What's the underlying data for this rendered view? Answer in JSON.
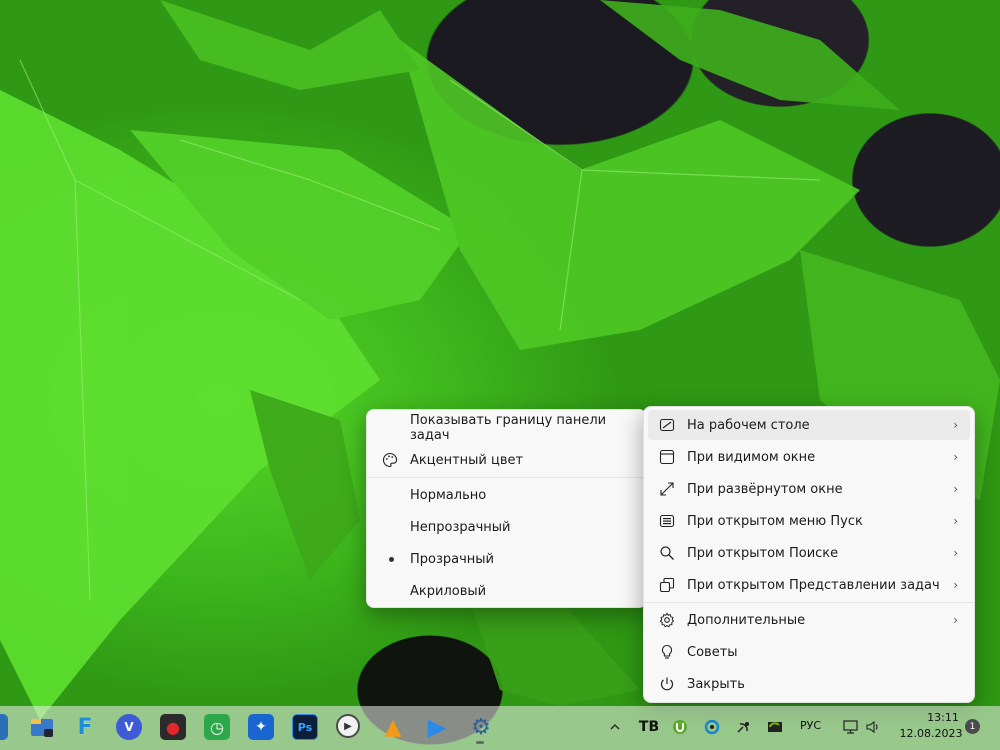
{
  "left_menu": {
    "items": [
      {
        "label": "Показывать границу панели задач",
        "icon": ""
      },
      {
        "label": "Акцентный цвет",
        "icon": "palette-icon"
      },
      {
        "label": "Нормально"
      },
      {
        "label": "Непрозрачный"
      },
      {
        "label": "Прозрачный",
        "selected": true
      },
      {
        "label": "Акриловый"
      }
    ]
  },
  "right_menu": {
    "items": [
      {
        "label": "На рабочем столе",
        "icon": "desktop-icon",
        "submenu": true,
        "highlighted": true
      },
      {
        "label": "При видимом окне",
        "icon": "window-icon",
        "submenu": true
      },
      {
        "label": "При развёрнутом окне",
        "icon": "maximize-icon",
        "submenu": true
      },
      {
        "label": "При открытом меню Пуск",
        "icon": "start-menu-icon",
        "submenu": true
      },
      {
        "label": "При открытом Поиске",
        "icon": "search-icon",
        "submenu": true
      },
      {
        "label": "При открытом Представлении задач",
        "icon": "task-view-icon",
        "submenu": true
      },
      {
        "label": "Дополнительные",
        "icon": "gear-icon",
        "submenu": true
      },
      {
        "label": "Советы",
        "icon": "lightbulb-icon"
      },
      {
        "label": "Закрыть",
        "icon": "power-icon"
      }
    ],
    "chevron": "›"
  },
  "taskbar": {
    "apps": [
      {
        "name": "app-explorer-icon",
        "letter": "",
        "color": "#3a78c9"
      },
      {
        "name": "app-f-icon",
        "letter": "F",
        "color": "#1d8fd8"
      },
      {
        "name": "app-vivaldi-icon",
        "letter": "V",
        "color": "#3d5bd6"
      },
      {
        "name": "app-recorder-icon",
        "letter": "●",
        "color": "#d9232a"
      },
      {
        "name": "app-timer-icon",
        "letter": "◷",
        "color": "#2ca84a"
      },
      {
        "name": "app-dots-icon",
        "letter": "✦",
        "color": "#1966d2"
      },
      {
        "name": "app-photoshop-icon",
        "letter": "Ps",
        "color": "#0c1f3a"
      },
      {
        "name": "app-player-icon",
        "letter": "▶",
        "color": "#4a4a4a"
      },
      {
        "name": "app-aimp-icon",
        "letter": "▲",
        "color": "#f29a1a"
      },
      {
        "name": "app-play-icon",
        "letter": "▶",
        "color": "#2a8be6"
      },
      {
        "name": "app-settings-icon",
        "letter": "⚙",
        "color": "#2d5f9a"
      }
    ],
    "tray": {
      "language": "РУС",
      "time": "13:11",
      "date": "12.08.2023",
      "notifications": "1"
    }
  }
}
